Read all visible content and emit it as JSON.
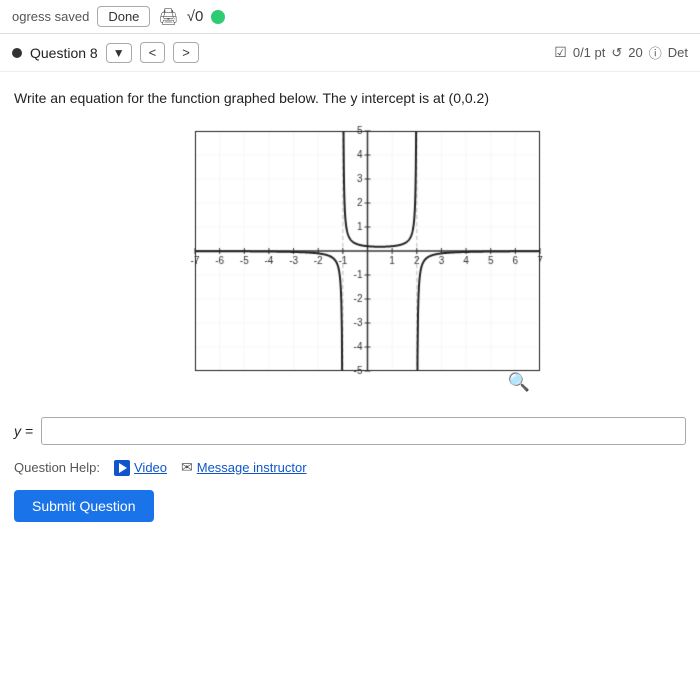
{
  "topbar": {
    "progress_text": "ogress saved",
    "done_label": "Done",
    "sqrt_symbol": "√0"
  },
  "questionbar": {
    "label": "Question 8",
    "dropdown_symbol": "▼",
    "prev_label": "<",
    "next_label": ">",
    "score": "0/1 pt",
    "attempts": "20",
    "detail_label": "Det"
  },
  "question": {
    "text": "Write an equation for the function graphed below. The y intercept is at (0,0.2)"
  },
  "graph": {
    "x_min": -7,
    "x_max": 7,
    "y_min": -5,
    "y_max": 5,
    "x_tick_labels": [
      "-7",
      "-6",
      "-5",
      "-4",
      "-3",
      "-2",
      "-1",
      "1",
      "2",
      "3",
      "4",
      "5",
      "6",
      "7"
    ],
    "y_tick_labels": [
      "-5",
      "-4",
      "-3",
      "-2",
      "-1",
      "1",
      "2",
      "3",
      "4",
      "5"
    ]
  },
  "answer": {
    "label": "y =",
    "placeholder": ""
  },
  "help": {
    "label": "Question Help:",
    "video_label": "Video",
    "message_label": "Message instructor"
  },
  "submit": {
    "label": "Submit Question"
  }
}
